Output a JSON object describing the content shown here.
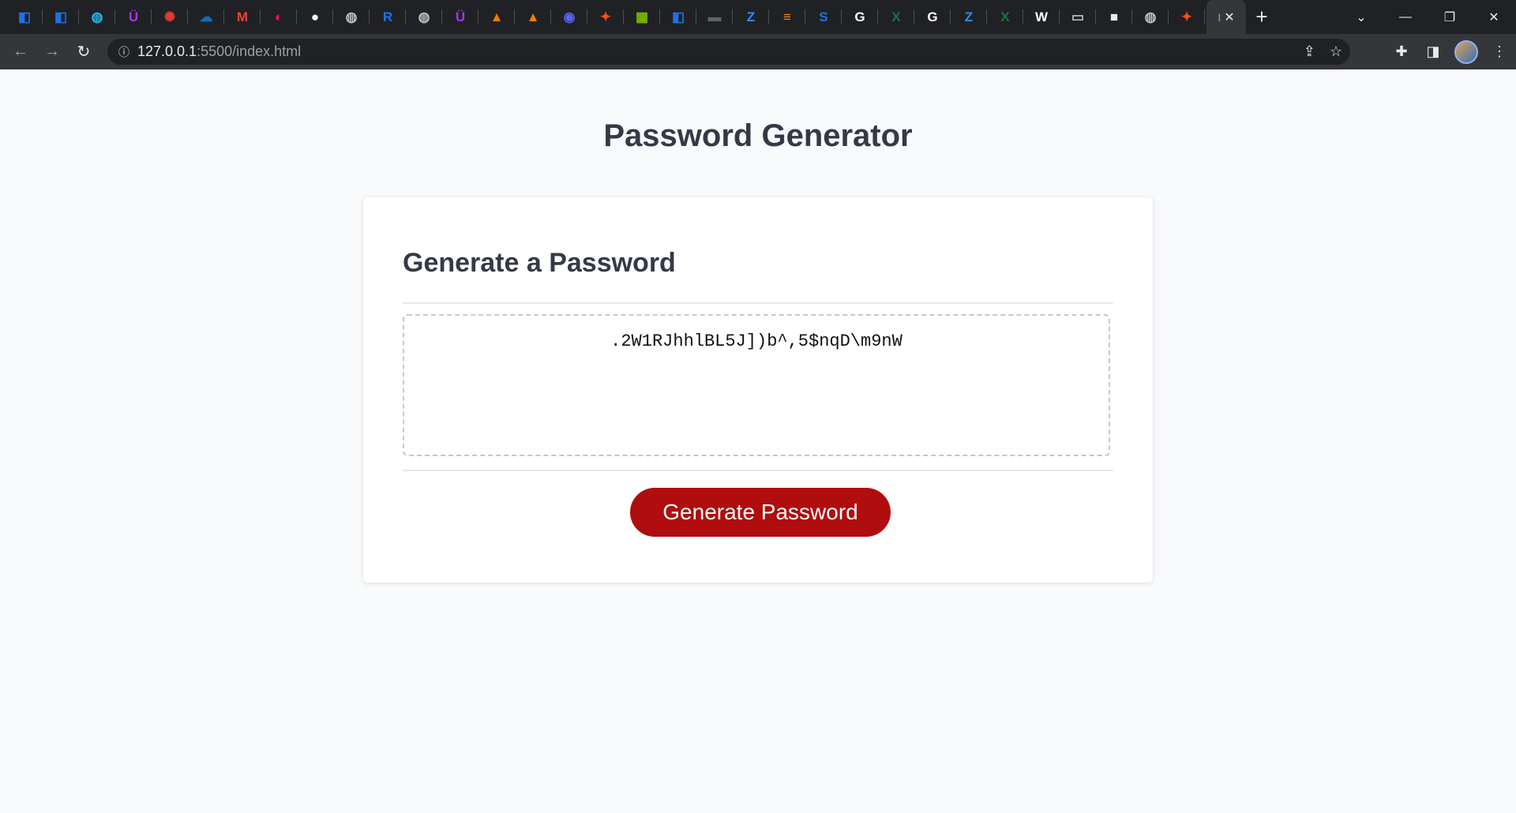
{
  "browser": {
    "tabs": [
      {
        "icon": "azure-icon",
        "color": "#1a73e8",
        "glyph": "◧"
      },
      {
        "icon": "azure-icon",
        "color": "#1a73e8",
        "glyph": "◧"
      },
      {
        "icon": "planet-icon",
        "color": "#2db3e6",
        "glyph": "◍"
      },
      {
        "icon": "udemy-icon",
        "color": "#a435f0",
        "glyph": "Ü"
      },
      {
        "icon": "asterisk-icon",
        "color": "#e03c31",
        "glyph": "✺"
      },
      {
        "icon": "onedrive-icon",
        "color": "#0f6cbd",
        "glyph": "☁"
      },
      {
        "icon": "gmail-icon",
        "color": "#ea4335",
        "glyph": "M"
      },
      {
        "icon": "figma-community-icon",
        "color": "#ff0a6c",
        "glyph": "◐"
      },
      {
        "icon": "github-icon",
        "color": "#ffffff",
        "glyph": "●"
      },
      {
        "icon": "globe-icon",
        "color": "#bdc1c6",
        "glyph": "◍"
      },
      {
        "icon": "r-icon",
        "color": "#1a73e8",
        "glyph": "R"
      },
      {
        "icon": "globe-icon",
        "color": "#bdc1c6",
        "glyph": "◍"
      },
      {
        "icon": "udemy-icon",
        "color": "#a435f0",
        "glyph": "Ü"
      },
      {
        "icon": "orange-app-icon",
        "color": "#f57c00",
        "glyph": "▲"
      },
      {
        "icon": "orange-app-icon",
        "color": "#f57c00",
        "glyph": "▲"
      },
      {
        "icon": "discord-icon",
        "color": "#5865f2",
        "glyph": "◉"
      },
      {
        "icon": "figma-icon",
        "color": "#f24e1e",
        "glyph": "✦"
      },
      {
        "icon": "microsoft-icon",
        "color": "#7fba00",
        "glyph": "▦"
      },
      {
        "icon": "azure-icon",
        "color": "#1a73e8",
        "glyph": "◧"
      },
      {
        "icon": "video-icon",
        "color": "#5f6368",
        "glyph": "▬"
      },
      {
        "icon": "zoom-icon",
        "color": "#2d8cff",
        "glyph": "Z"
      },
      {
        "icon": "stackoverflow-icon",
        "color": "#f48024",
        "glyph": "≡"
      },
      {
        "icon": "s-app-icon",
        "color": "#1a73e8",
        "glyph": "S"
      },
      {
        "icon": "google-icon",
        "color": "#ffffff",
        "glyph": "G"
      },
      {
        "icon": "excel-icon",
        "color": "#1d6f42",
        "glyph": "X"
      },
      {
        "icon": "google-icon",
        "color": "#ffffff",
        "glyph": "G"
      },
      {
        "icon": "zoom-icon",
        "color": "#2d8cff",
        "glyph": "Z"
      },
      {
        "icon": "excel-icon",
        "color": "#1d6f42",
        "glyph": "X"
      },
      {
        "icon": "wordpress-icon",
        "color": "#ffffff",
        "glyph": "W"
      },
      {
        "icon": "tab-icon",
        "color": "#bdc1c6",
        "glyph": "▭"
      },
      {
        "icon": "video-icon",
        "color": "#e8eaed",
        "glyph": "■"
      },
      {
        "icon": "globe-icon",
        "color": "#bdc1c6",
        "glyph": "◍"
      },
      {
        "icon": "figma-icon",
        "color": "#f24e1e",
        "glyph": "✦"
      }
    ],
    "active_tab_glyph": "I",
    "active_tab_close": "✕",
    "new_tab": "+",
    "controls": {
      "dropdown": "⌄",
      "minimize": "—",
      "restore": "❐",
      "close": "✕"
    },
    "nav": {
      "back": "←",
      "forward": "→",
      "reload": "↻"
    },
    "address": {
      "info_icon": "ⓘ",
      "host": "127.0.0.1",
      "path": ":5500/index.html"
    },
    "omnibox_right": {
      "share": "⇪",
      "star": "☆"
    },
    "toolbar_right": {
      "extensions": "✚",
      "sidepanel": "◨",
      "menu": "⋮"
    }
  },
  "page": {
    "title": "Password Generator",
    "card_header": "Generate a Password",
    "password": ".2W1RJhhlBL5J])b^,5$nqD\\m9nW",
    "button_label": "Generate Password"
  },
  "colors": {
    "button": "#b00d0e",
    "title_text": "#343a45",
    "background": "#f9fafb"
  }
}
